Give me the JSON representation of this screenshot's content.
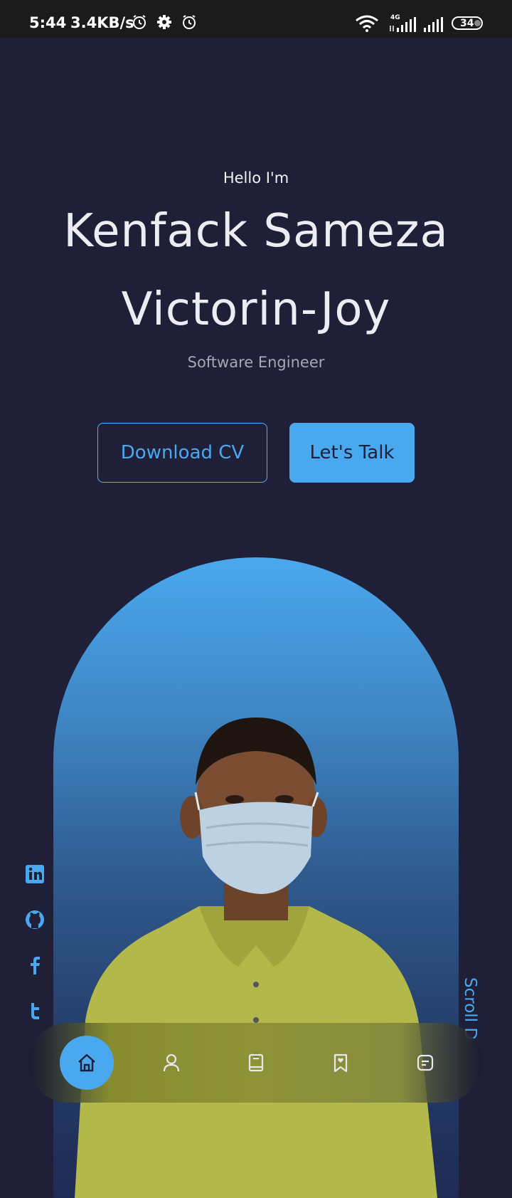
{
  "status_bar": {
    "time": "5:44",
    "speed": "3.4KB/s",
    "network": "4G",
    "battery": "34",
    "icons": [
      "alarm-icon",
      "gear-icon",
      "alarm-icon",
      "wifi-icon",
      "signal-icon",
      "signal-icon",
      "battery-icon"
    ]
  },
  "hero": {
    "greeting": "Hello I'm",
    "name_line1": "Kenfack Sameza",
    "name_line2": "Victorin-Joy",
    "role": "Software Engineer",
    "download_cv": "Download CV",
    "lets_talk": "Let's Talk",
    "scroll_text": "Scroll D"
  },
  "socials": [
    "linkedin-icon",
    "github-icon",
    "facebook-icon",
    "twitter-icon"
  ],
  "nav": {
    "items": [
      "home-icon",
      "user-icon",
      "book-icon",
      "bookmark-icon",
      "message-icon"
    ],
    "active": "home-icon"
  },
  "colors": {
    "background": "#1f1f38",
    "accent": "#4aa8ee",
    "text_muted": "#a7a7b5"
  }
}
